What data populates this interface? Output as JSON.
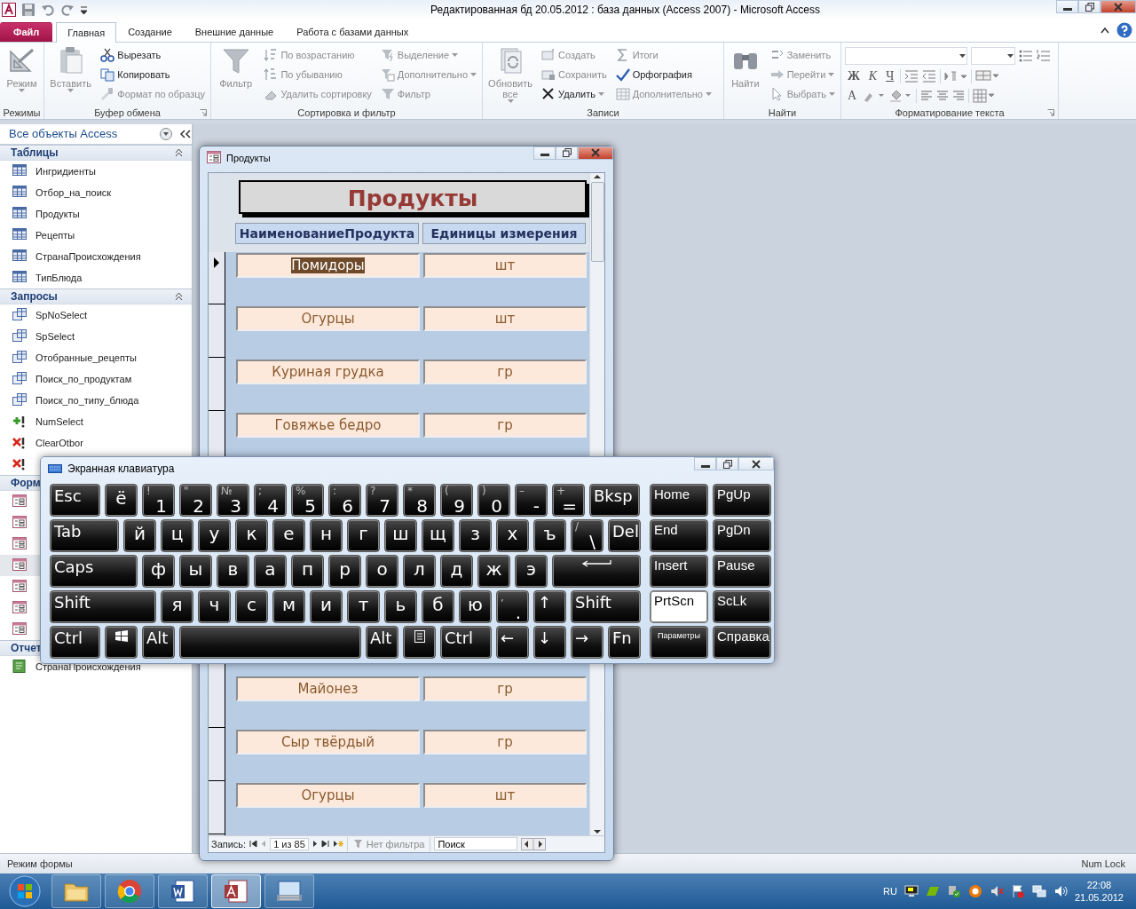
{
  "window": {
    "title": "Редактированная бд 20.05.2012 : база данных (Access 2007)  -  Microsoft Access"
  },
  "tabs": [
    {
      "label": "Файл",
      "kind": "file",
      "selected": false
    },
    {
      "label": "Главная",
      "kind": "tab",
      "selected": true
    },
    {
      "label": "Создание",
      "kind": "tab",
      "selected": false
    },
    {
      "label": "Внешние данные",
      "kind": "tab",
      "selected": false
    },
    {
      "label": "Работа с базами данных",
      "kind": "tab",
      "selected": false
    }
  ],
  "ribbon": {
    "groups": [
      {
        "kind": "buttons",
        "label": "Режимы",
        "launcher": false,
        "large": {
          "label": "Режим",
          "disabled": true,
          "dropdown": true
        }
      },
      {
        "kind": "buttons",
        "label": "Буфер обмена",
        "launcher": true,
        "large": {
          "label": "Вставить",
          "disabled": true,
          "dropdown": true
        },
        "columns": [
          [
            {
              "label": "Вырезать",
              "disabled": false,
              "dropdown": false
            },
            {
              "label": "Копировать",
              "disabled": false,
              "dropdown": false
            },
            {
              "label": "Формат по образцу",
              "disabled": true,
              "dropdown": false
            }
          ]
        ]
      },
      {
        "kind": "buttons",
        "label": "Сортировка и фильтр",
        "launcher": false,
        "large": {
          "label": "Фильтр",
          "disabled": true,
          "dropdown": false
        },
        "columns": [
          [
            {
              "label": "По возрастанию",
              "disabled": true,
              "dropdown": false
            },
            {
              "label": "По убыванию",
              "disabled": true,
              "dropdown": false
            },
            {
              "label": "Удалить сортировку",
              "disabled": true,
              "dropdown": false
            }
          ],
          [
            {
              "label": "Выделение",
              "disabled": true,
              "dropdown": true
            },
            {
              "label": "Дополнительно",
              "disabled": true,
              "dropdown": true
            },
            {
              "label": "Фильтр",
              "disabled": true,
              "dropdown": false
            }
          ]
        ]
      },
      {
        "kind": "buttons",
        "label": "Записи",
        "launcher": false,
        "large": {
          "label": "Обновить все",
          "disabled": true,
          "dropdown": true
        },
        "columns": [
          [
            {
              "label": "Создать",
              "disabled": true,
              "dropdown": false
            },
            {
              "label": "Сохранить",
              "disabled": true,
              "dropdown": false
            },
            {
              "label": "Удалить",
              "disabled": false,
              "dropdown": true
            }
          ],
          [
            {
              "label": "Итоги",
              "disabled": true,
              "dropdown": false
            },
            {
              "label": "Орфография",
              "disabled": false,
              "dropdown": false
            },
            {
              "label": "Дополнительно",
              "disabled": true,
              "dropdown": true
            }
          ]
        ]
      },
      {
        "kind": "buttons",
        "label": "Найти",
        "launcher": false,
        "large": {
          "label": "Найти",
          "disabled": true,
          "dropdown": false
        },
        "columns": [
          [
            {
              "label": "Заменить",
              "disabled": true,
              "dropdown": false
            },
            {
              "label": "Перейти",
              "disabled": true,
              "dropdown": true
            },
            {
              "label": "Выбрать",
              "disabled": true,
              "dropdown": true
            }
          ]
        ]
      },
      {
        "kind": "format",
        "label": "Форматирование текста",
        "launcher": true,
        "style_buttons": [
          "Ж",
          "К",
          "Ч"
        ],
        "font_color_button": "A"
      }
    ]
  },
  "nav": {
    "title": "Все объекты Access",
    "sections": [
      {
        "label": "Таблицы",
        "expanded": true,
        "items": [
          {
            "label": "Ингридиенты",
            "kind": "table",
            "selected": false
          },
          {
            "label": "Отбор_на_поиск",
            "kind": "table",
            "selected": false
          },
          {
            "label": "Продукты",
            "kind": "table",
            "selected": false
          },
          {
            "label": "Рецепты",
            "kind": "table",
            "selected": false
          },
          {
            "label": "СтранаПроисхождения",
            "kind": "table",
            "selected": false
          },
          {
            "label": "ТипБлюда",
            "kind": "table",
            "selected": false
          }
        ]
      },
      {
        "label": "Запросы",
        "expanded": true,
        "items": [
          {
            "label": "SpNoSelect",
            "kind": "select",
            "selected": false
          },
          {
            "label": "SpSelect",
            "kind": "select",
            "selected": false
          },
          {
            "label": "Отобранные_рецепты",
            "kind": "select",
            "selected": false
          },
          {
            "label": "Поиск_по_продуктам",
            "kind": "select",
            "selected": false
          },
          {
            "label": "Поиск_по_типу_блюда",
            "kind": "select",
            "selected": false
          },
          {
            "label": "NumSelect",
            "kind": "append",
            "selected": false
          },
          {
            "label": "ClearOtbor",
            "kind": "delete",
            "selected": false
          },
          {
            "kind": "delete",
            "selected": false
          }
        ]
      },
      {
        "label": "Форм",
        "expanded": true,
        "items": [
          {
            "kind": "form",
            "selected": false
          },
          {
            "kind": "form",
            "selected": false
          },
          {
            "kind": "form",
            "selected": false
          },
          {
            "kind": "form",
            "selected": true
          },
          {
            "kind": "form",
            "selected": false
          },
          {
            "kind": "form",
            "selected": false
          },
          {
            "kind": "form",
            "selected": false
          }
        ]
      },
      {
        "label": "Отчет",
        "expanded": true,
        "items": [
          {
            "label": "СтранаПроисхождения",
            "kind": "report",
            "selected": false
          }
        ]
      }
    ]
  },
  "form": {
    "title": "Продукты",
    "heading": "Продукты",
    "columns": [
      "НаименованиеПродукта",
      "Единицы измерения"
    ],
    "rows_top": [
      {
        "name": "Помидоры",
        "unit": "шт",
        "current": true
      },
      {
        "name": "Огурцы",
        "unit": "шт",
        "current": false
      },
      {
        "name": "Куриная грудка",
        "unit": "гр",
        "current": false
      },
      {
        "name": "Говяжье бедро",
        "unit": "гр",
        "current": false
      }
    ],
    "rows_bottom": [
      {
        "name": "Майонез",
        "unit": "гр",
        "current": false
      },
      {
        "name": "Сыр твёрдый",
        "unit": "гр",
        "current": false
      },
      {
        "name": "Огурцы",
        "unit": "шт",
        "current": false
      }
    ],
    "record_nav": {
      "label": "Запись:",
      "position": "1 из 85",
      "filter": "Нет фильтра",
      "search_placeholder": "Поиск"
    }
  },
  "keyboard": {
    "title": "Экранная клавиатура",
    "rows": [
      {
        "keys": [
          {
            "kind": "label",
            "text": "Esc"
          },
          {
            "kind": "char",
            "text": "ё"
          },
          {
            "kind": "dual",
            "top": "!",
            "text": "1"
          },
          {
            "kind": "dual",
            "top": "\"",
            "text": "2"
          },
          {
            "kind": "dual",
            "top": "№",
            "text": "3"
          },
          {
            "kind": "dual",
            "top": ";",
            "text": "4"
          },
          {
            "kind": "dual",
            "top": "%",
            "text": "5"
          },
          {
            "kind": "dual",
            "top": ":",
            "text": "6"
          },
          {
            "kind": "dual",
            "top": "?",
            "text": "7"
          },
          {
            "kind": "dual",
            "top": "*",
            "text": "8"
          },
          {
            "kind": "dual",
            "top": "(",
            "text": "9"
          },
          {
            "kind": "dual",
            "top": ")",
            "text": "0"
          },
          {
            "kind": "dual",
            "top": "–",
            "text": "-"
          },
          {
            "kind": "dual",
            "top": "+",
            "text": "="
          },
          {
            "kind": "label",
            "text": "Bksp"
          }
        ]
      },
      {
        "keys": [
          {
            "kind": "label",
            "text": "Tab"
          },
          {
            "kind": "char",
            "text": "й"
          },
          {
            "kind": "char",
            "text": "ц"
          },
          {
            "kind": "char",
            "text": "у"
          },
          {
            "kind": "char",
            "text": "к"
          },
          {
            "kind": "char",
            "text": "е"
          },
          {
            "kind": "char",
            "text": "н"
          },
          {
            "kind": "char",
            "text": "г"
          },
          {
            "kind": "char",
            "text": "ш"
          },
          {
            "kind": "char",
            "text": "щ"
          },
          {
            "kind": "char",
            "text": "з"
          },
          {
            "kind": "char",
            "text": "х"
          },
          {
            "kind": "char",
            "text": "ъ"
          },
          {
            "kind": "dual",
            "top": "/",
            "text": "\\"
          },
          {
            "kind": "label",
            "text": "Del"
          }
        ]
      },
      {
        "keys": [
          {
            "kind": "label",
            "text": "Caps"
          },
          {
            "kind": "char",
            "text": "ф"
          },
          {
            "kind": "char",
            "text": "ы"
          },
          {
            "kind": "char",
            "text": "в"
          },
          {
            "kind": "char",
            "text": "а"
          },
          {
            "kind": "char",
            "text": "п"
          },
          {
            "kind": "char",
            "text": "р"
          },
          {
            "kind": "char",
            "text": "о"
          },
          {
            "kind": "char",
            "text": "л"
          },
          {
            "kind": "char",
            "text": "д"
          },
          {
            "kind": "char",
            "text": "ж"
          },
          {
            "kind": "char",
            "text": "э"
          },
          {
            "kind": "enter"
          }
        ]
      },
      {
        "keys": [
          {
            "kind": "label",
            "text": "Shift"
          },
          {
            "kind": "char",
            "text": "я"
          },
          {
            "kind": "char",
            "text": "ч"
          },
          {
            "kind": "char",
            "text": "с"
          },
          {
            "kind": "char",
            "text": "м"
          },
          {
            "kind": "char",
            "text": "и"
          },
          {
            "kind": "char",
            "text": "т"
          },
          {
            "kind": "char",
            "text": "ь"
          },
          {
            "kind": "char",
            "text": "б"
          },
          {
            "kind": "char",
            "text": "ю"
          },
          {
            "kind": "dual",
            "top": ",",
            "text": "."
          },
          {
            "kind": "label",
            "text": "↑"
          },
          {
            "kind": "label",
            "text": "Shift"
          }
        ]
      },
      {
        "keys": [
          {
            "kind": "label",
            "text": "Ctrl"
          },
          {
            "kind": "win"
          },
          {
            "kind": "label",
            "text": "Alt"
          },
          {
            "kind": "space"
          },
          {
            "kind": "label",
            "text": "Alt"
          },
          {
            "kind": "menu"
          },
          {
            "kind": "label",
            "text": "Ctrl"
          },
          {
            "kind": "label",
            "text": "←"
          },
          {
            "kind": "label",
            "text": "↓"
          },
          {
            "kind": "label",
            "text": "→"
          },
          {
            "kind": "label",
            "text": "Fn"
          }
        ]
      }
    ],
    "side_keys": [
      {
        "text": "Home",
        "kind": "label",
        "active": false
      },
      {
        "text": "PgUp",
        "kind": "label",
        "active": false
      },
      {
        "text": "End",
        "kind": "label",
        "active": false
      },
      {
        "text": "PgDn",
        "kind": "label",
        "active": false
      },
      {
        "text": "Insert",
        "kind": "label",
        "active": false
      },
      {
        "text": "Pause",
        "kind": "label",
        "active": false
      },
      {
        "text": "PrtScn",
        "kind": "label",
        "active": true
      },
      {
        "text": "ScLk",
        "kind": "label",
        "active": false
      },
      {
        "text": "Параметры",
        "kind": "small",
        "active": false
      },
      {
        "text": "Справка",
        "kind": "label",
        "active": false
      }
    ]
  },
  "status_bar": {
    "left": "Режим формы",
    "right": "Num Lock"
  },
  "taskbar": {
    "apps": [
      {
        "kind": "folder",
        "selected": false
      },
      {
        "kind": "browser",
        "selected": false
      },
      {
        "kind": "word",
        "selected": false
      },
      {
        "kind": "access",
        "selected": true
      },
      {
        "kind": "keyboard",
        "selected": false
      }
    ],
    "language": "RU",
    "time": "22:08",
    "date": "21.05.2012"
  }
}
